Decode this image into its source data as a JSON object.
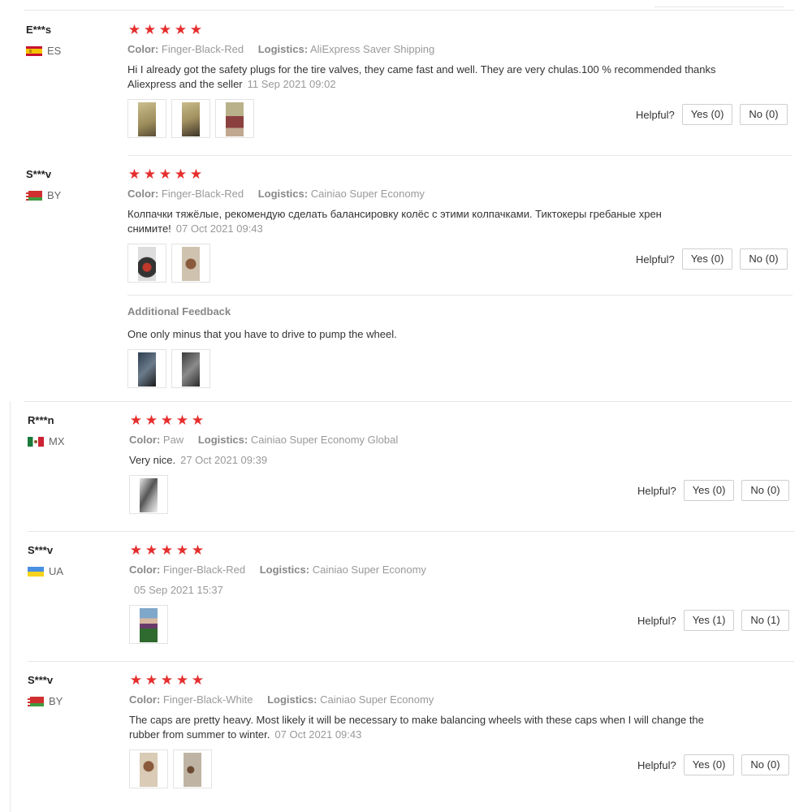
{
  "labels": {
    "color": "Color:",
    "logistics": "Logistics:",
    "helpful": "Helpful?",
    "additional_feedback": "Additional Feedback"
  },
  "colors": {
    "star": "#e62e2e",
    "border": "#e6e6e6"
  },
  "reviews": [
    {
      "user": "E***s",
      "country": "ES",
      "flag": "spain-flag",
      "rating": 5,
      "color_value": "Finger-Black-Red",
      "logistics_value": "AliExpress Saver Shipping",
      "text": "Hi I already got the safety plugs for the tire valves, they came fast and well. They are very chulas.100 % recommended thanks Aliexpress and the seller",
      "date": "11 Sep 2021 09:02",
      "photos": 3,
      "yes": "Yes (0)",
      "no": "No (0)"
    },
    {
      "user": "S***v",
      "country": "BY",
      "flag": "belarus-flag",
      "rating": 5,
      "color_value": "Finger-Black-Red",
      "logistics_value": "Cainiao Super Economy",
      "text": "Колпачки тяжёлые, рекомендую сделать балансировку колёс с этими колпачками. Тиктокеры гребаные хрен снимите!",
      "date": "07 Oct 2021 09:43",
      "photos": 2,
      "yes": "Yes (0)",
      "no": "No (0)",
      "additional_feedback": {
        "text": "One only minus that you have to drive to pump the wheel.",
        "photos": 2
      }
    },
    {
      "user": "R***n",
      "country": "MX",
      "flag": "mexico-flag",
      "rating": 5,
      "color_value": "Paw",
      "logistics_value": "Cainiao Super Economy Global",
      "text": "Very nice.",
      "date": "27 Oct 2021 09:39",
      "photos": 1,
      "yes": "Yes (0)",
      "no": "No (0)"
    },
    {
      "user": "S***v",
      "country": "UA",
      "flag": "ukraine-flag",
      "rating": 5,
      "color_value": "Finger-Black-Red",
      "logistics_value": "Cainiao Super Economy",
      "text": "",
      "date": "05 Sep 2021 15:37",
      "photos": 1,
      "yes": "Yes (1)",
      "no": "No (1)"
    },
    {
      "user": "S***v",
      "country": "BY",
      "flag": "belarus-flag",
      "rating": 5,
      "color_value": "Finger-Black-White",
      "logistics_value": "Cainiao Super Economy",
      "text": "The caps are pretty heavy. Most likely it will be necessary to make balancing wheels with these caps when I will change the rubber from summer to winter.",
      "date": "07 Oct 2021 09:43",
      "photos": 2,
      "yes": "Yes (0)",
      "no": "No (0)"
    }
  ]
}
